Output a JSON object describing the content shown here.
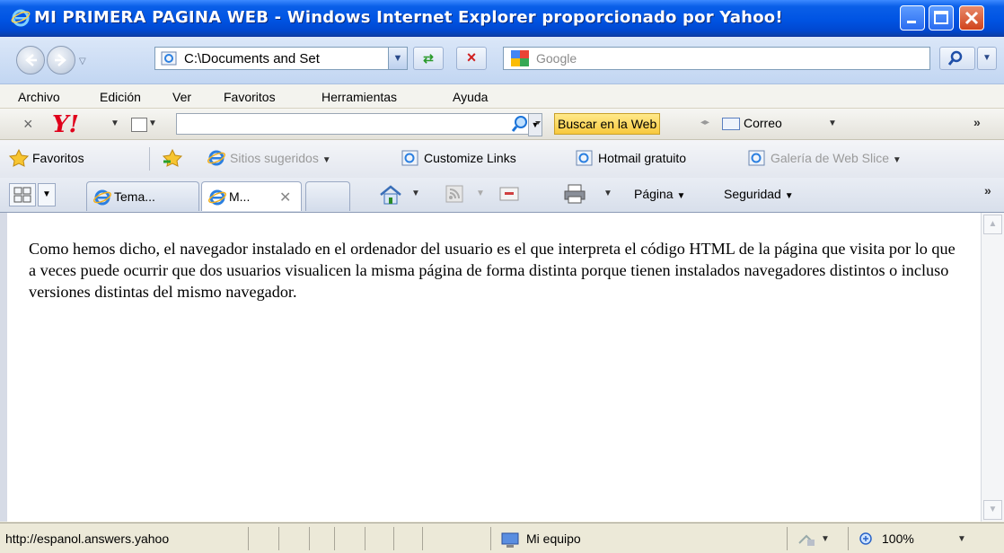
{
  "window": {
    "title": "MI PRIMERA PAGINA WEB - Windows Internet Explorer proporcionado por Yahoo!",
    "controls": [
      "minimize-icon",
      "maximize-icon",
      "close-icon"
    ]
  },
  "address_bar": {
    "url": "C:\\Documents and Set",
    "search_placeholder": "Google"
  },
  "menu": {
    "items": [
      {
        "label": "Archivo"
      },
      {
        "label": "Edición"
      },
      {
        "label": "Ver"
      },
      {
        "label": "Favoritos"
      },
      {
        "label": "Herramientas"
      },
      {
        "label": "Ayuda"
      }
    ]
  },
  "yahoo_toolbar": {
    "close_glyph": "×",
    "logo": "Y!",
    "search_value": "",
    "search_button": "Buscar en la Web",
    "mail_label": "Correo",
    "more_glyph": "»",
    "brand_color": "#e0001b"
  },
  "favorites_bar": {
    "favorites_label": "Favoritos",
    "items": [
      {
        "label": "Sitios sugeridos"
      },
      {
        "label": "Customize Links"
      },
      {
        "label": "Hotmail gratuito"
      },
      {
        "label": "Galería de Web Slice"
      }
    ]
  },
  "tabs": {
    "items": [
      {
        "label": "Tema..."
      },
      {
        "label": "M..."
      }
    ]
  },
  "command_bar": {
    "page_label": "Página",
    "security_label": "Seguridad",
    "more_glyph": "»"
  },
  "content": {
    "paragraph": "Como hemos dicho, el navegador instalado en el ordenador del usuario es el que interpreta el código HTML de la página que visita por lo que a veces puede ocurrir que dos usuarios visualicen la misma página de forma distinta porque tienen instalados navegadores distintos o incluso versiones distintas del mismo navegador."
  },
  "status_bar": {
    "url": "http://espanol.answers.yahoo",
    "zone": "Mi equipo",
    "zoom": "100%"
  }
}
